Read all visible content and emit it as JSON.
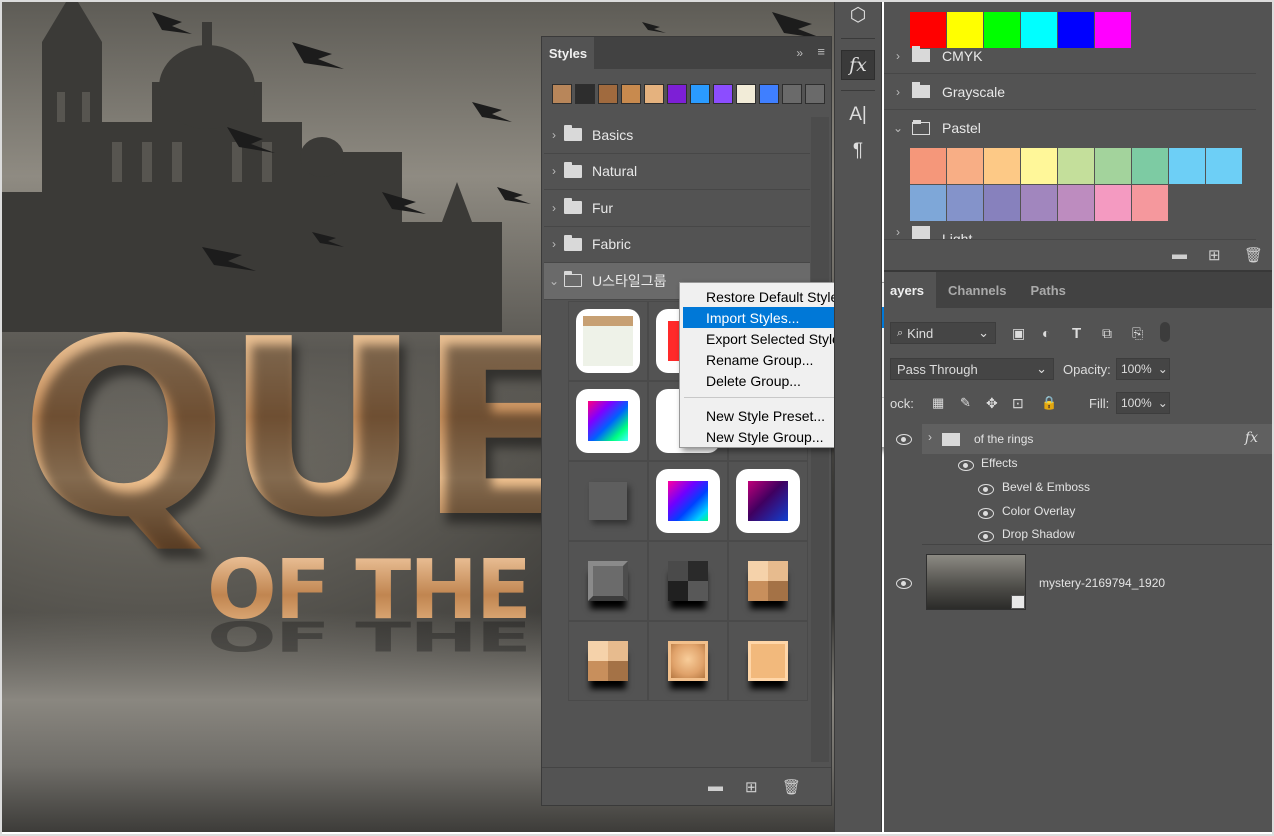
{
  "canvas": {
    "title_line": "QUEE",
    "subtitle_line": "OF THE R"
  },
  "styles_panel": {
    "tab_label": "Styles",
    "collapse_glyph": "»",
    "menu_glyph": "≡",
    "recent_swatches": [
      "#b8865a",
      "#2d2d2d",
      "#a06a3e",
      "#c88a4e",
      "#e5b27e",
      "#7d1fd6",
      "#2a9bff",
      "#8c4dff",
      "#f2ecd8",
      "#3f7fff",
      "#6a6a6a",
      "#6a6a6a"
    ],
    "groups": [
      {
        "label": "Basics"
      },
      {
        "label": "Natural"
      },
      {
        "label": "Fur"
      },
      {
        "label": "Fabric"
      },
      {
        "label": "U스타일그룹"
      }
    ]
  },
  "context_menu": {
    "items": [
      {
        "label": "Restore Default Styles..."
      },
      {
        "label": "Import Styles..."
      },
      {
        "label": "Export Selected Styles..."
      },
      {
        "label": "Rename Group..."
      },
      {
        "label": "Delete Group..."
      },
      {
        "label": "New Style Preset..."
      },
      {
        "label": "New Style Group..."
      }
    ],
    "highlighted_index": 1
  },
  "tool_strip": {
    "fx_label": "fx",
    "char_label": "A|",
    "para_label": "¶"
  },
  "swatches_panel": {
    "top_colors": [
      "#ff0000",
      "#ffff00",
      "#00ff00",
      "#00ffff",
      "#0000ff",
      "#ff00ff"
    ],
    "groups": [
      {
        "label": "CMYK"
      },
      {
        "label": "Grayscale"
      },
      {
        "label": "Pastel"
      },
      {
        "label": "Light"
      }
    ],
    "pastel_colors": [
      "#f5977a",
      "#f8ae85",
      "#fdc986",
      "#fff799",
      "#c4df9b",
      "#a3d39c",
      "#7dcba3",
      "#6dcff6",
      "#6dcff6",
      "#7ea7d8",
      "#8493ca",
      "#8781bd",
      "#a186be",
      "#bd8cbf",
      "#f49ac1",
      "#f5989d"
    ]
  },
  "layers_panel": {
    "tabs": [
      "Layers",
      "Channels",
      "Paths"
    ],
    "tab_visible": [
      "ayers",
      "Channels",
      "Paths"
    ],
    "filter_label": "Kind",
    "blend_mode": "Pass Through",
    "opacity_label": "Opacity:",
    "opacity_value": "100%",
    "lock_label": "ock:",
    "fill_label": "Fill:",
    "fill_value": "100%",
    "group_layer_name": "of the rings",
    "fx_badge": "fx",
    "effects_label": "Effects",
    "effects": [
      "Bevel & Emboss",
      "Color Overlay",
      "Drop Shadow"
    ],
    "image_layer_name": "mystery-2169794_1920"
  }
}
